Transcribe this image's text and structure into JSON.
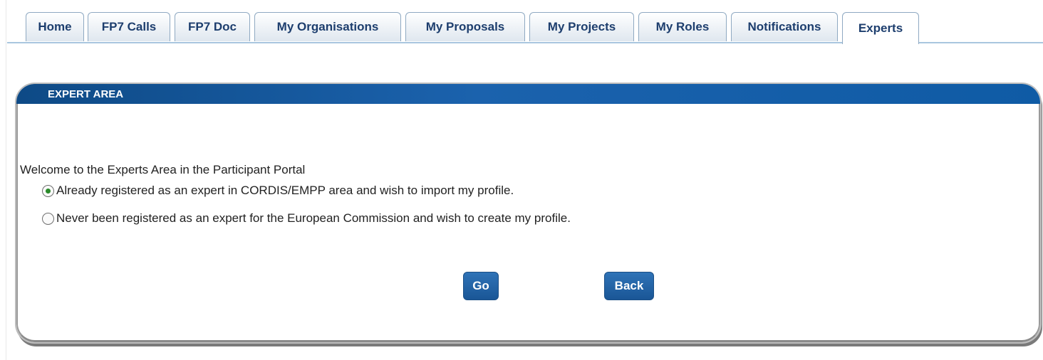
{
  "tabs": [
    {
      "label": "Home"
    },
    {
      "label": "FP7 Calls"
    },
    {
      "label": "FP7 Doc"
    },
    {
      "label": "My Organisations"
    },
    {
      "label": "My Proposals"
    },
    {
      "label": "My Projects"
    },
    {
      "label": "My Roles"
    },
    {
      "label": "Notifications"
    },
    {
      "label": "Experts",
      "active": true
    }
  ],
  "panel": {
    "title": "EXPERT AREA",
    "welcome": "Welcome to the Experts Area in the Participant Portal",
    "options": [
      {
        "label": "Already registered as an expert in CORDIS/EMPP area and wish to import my profile.",
        "checked": true
      },
      {
        "label": "Never been registered as an expert for the European Commission and wish to create my profile.",
        "checked": false
      }
    ],
    "buttons": {
      "go": "Go",
      "back": "Back"
    }
  },
  "colors": {
    "header_blue": "#1b62ad",
    "button_blue": "#2f73b7",
    "tab_text": "#1d3e6e"
  },
  "icons": [
    "radio-checked-icon",
    "radio-unchecked-icon"
  ]
}
